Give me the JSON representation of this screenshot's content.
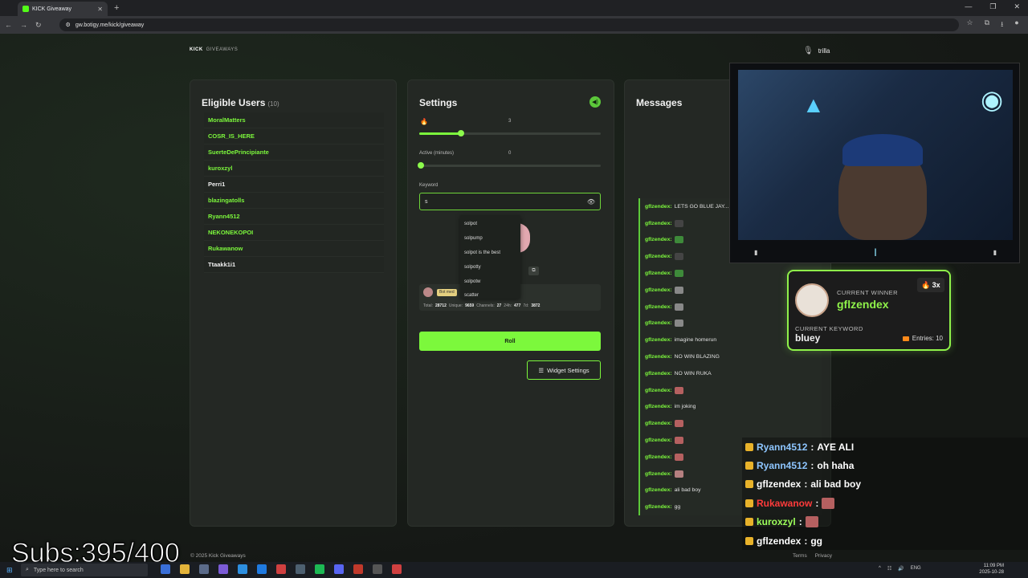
{
  "browser": {
    "tab_title": "KICK Giveaway",
    "url": "gw.botigy.me/kick/giveaway"
  },
  "brand": {
    "logo": "KICK",
    "label": "GIVEAWAYS"
  },
  "eligible": {
    "title": "Eligible Users",
    "count": "(10)",
    "users": [
      {
        "name": "MoralMatters",
        "color": "#7cf83c"
      },
      {
        "name": "COSR_IS_HERE",
        "color": "#7cf83c"
      },
      {
        "name": "SuerteDePrincipiante",
        "color": "#7cf83c"
      },
      {
        "name": "kuroxzyl",
        "color": "#7cf83c"
      },
      {
        "name": "Perri1",
        "color": "#f0f0f0"
      },
      {
        "name": "blazingatolls",
        "color": "#7cf83c"
      },
      {
        "name": "Ryann4512",
        "color": "#7cf83c"
      },
      {
        "name": "NEKONEKOPOI",
        "color": "#7cf83c"
      },
      {
        "name": "Rukawanow",
        "color": "#7cf83c"
      },
      {
        "name": "Ttaakk1i1",
        "color": "#f0f0f0"
      }
    ]
  },
  "settings": {
    "title": "Settings",
    "slider1": {
      "value": "3",
      "fraction": 0.23
    },
    "slider2": {
      "label": "Active (minutes)",
      "value": "0",
      "fraction": 0.01
    },
    "keyword_label": "Keyword",
    "keyword_value": "s",
    "suggestions": [
      "solpot",
      "solpump",
      "solpot is the best",
      "solpotty",
      "solpotw",
      "scatter"
    ],
    "stats": {
      "badge": "Bot med",
      "total_label": "Total:",
      "total": "28712",
      "unique_label": "Unique:",
      "unique": "9659",
      "channels_label": "Channels:",
      "channels": "27",
      "h24_label": "24h:",
      "h24": "477",
      "d7_label": "7d:",
      "d7": "3872"
    },
    "roll_label": "Roll",
    "widget_label": "Widget Settings"
  },
  "messages": {
    "title": "Messages",
    "items": [
      {
        "name": "gflzendex:",
        "text": "LETS GO BLUE JAY...",
        "emote": ""
      },
      {
        "name": "gflzendex:",
        "text": "",
        "emote": "#444"
      },
      {
        "name": "gflzendex:",
        "text": "",
        "emote": "#3e8a3a"
      },
      {
        "name": "gflzendex:",
        "text": "",
        "emote": "#444"
      },
      {
        "name": "gflzendex:",
        "text": "",
        "emote": "#3e8a3a"
      },
      {
        "name": "gflzendex:",
        "text": "",
        "emote": "#888"
      },
      {
        "name": "gflzendex:",
        "text": "",
        "emote": "#888"
      },
      {
        "name": "gflzendex:",
        "text": "",
        "emote": "#888"
      },
      {
        "name": "gflzendex:",
        "text": "imagine homerun",
        "emote": ""
      },
      {
        "name": "gflzendex:",
        "text": "NO WIN BLAZING",
        "emote": ""
      },
      {
        "name": "gflzendex:",
        "text": "NO WIN RUKA",
        "emote": ""
      },
      {
        "name": "gflzendex:",
        "text": "",
        "emote": "#b56060"
      },
      {
        "name": "gflzendex:",
        "text": "im joking",
        "emote": ""
      },
      {
        "name": "gflzendex:",
        "text": "",
        "emote": "#b56060"
      },
      {
        "name": "gflzendex:",
        "text": "",
        "emote": "#b56060"
      },
      {
        "name": "gflzendex:",
        "text": "",
        "emote": "#b56060"
      },
      {
        "name": "gflzendex:",
        "text": "",
        "emote": "#b58080"
      },
      {
        "name": "gflzendex:",
        "text": "ali bad boy",
        "emote": ""
      },
      {
        "name": "gflzendex:",
        "text": "gg",
        "emote": ""
      }
    ]
  },
  "footer": {
    "copyright": "© 2025 Kick Giveaways",
    "terms": "Terms",
    "privacy": "Privacy"
  },
  "stream": {
    "streamer": "trilla",
    "watermark": "TRILLA"
  },
  "winner": {
    "current_label": "CURRENT WINNER",
    "name": "gflzendex",
    "multiplier": "3x",
    "keyword_label": "CURRENT KEYWORD",
    "keyword": "bluey",
    "entries": "Entries: 10"
  },
  "chat_overlay": [
    {
      "name": "Ryann4512",
      "text": "AYE ALI",
      "color": "#8ec6ff"
    },
    {
      "name": "Ryann4512",
      "text": "oh haha",
      "color": "#8ec6ff"
    },
    {
      "name": "gflzendex",
      "text": "ali bad boy",
      "color": "#ffffff"
    },
    {
      "name": "Rukawanow",
      "text": "",
      "color": "#ff3b3b"
    },
    {
      "name": "kuroxzyl",
      "text": "",
      "color": "#9dff5a"
    },
    {
      "name": "gflzendex",
      "text": "gg",
      "color": "#ffffff"
    }
  ],
  "subs": "Subs:395/400",
  "taskbar": {
    "search": "Type here to search",
    "lang": "ENG",
    "time": "11:09 PM",
    "date": "2025-10-28"
  }
}
